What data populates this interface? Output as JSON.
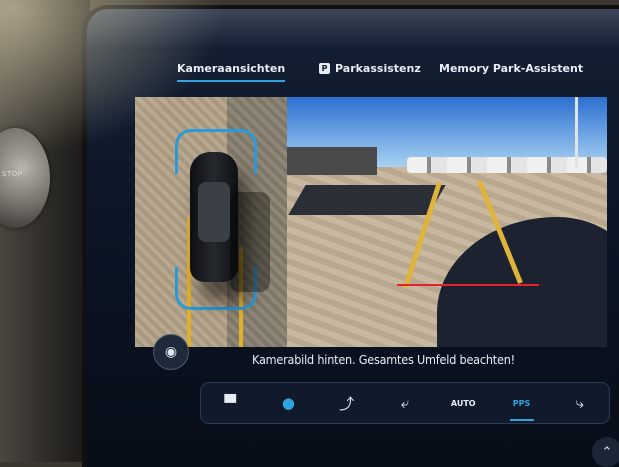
{
  "tabs": [
    {
      "label": "Kameraansichten",
      "active": true
    },
    {
      "label": "Parkassistenz",
      "icon": "parking-p-icon",
      "active": false
    },
    {
      "label": "Memory Park-Assistent",
      "active": false
    }
  ],
  "parking_icon_letter": "P",
  "knob": {
    "label": "STOP"
  },
  "notice": "Kamerabild hinten. Gesamtes Umfeld beachten!",
  "view_buttons": [
    {
      "name": "front-view-icon",
      "glyph": "▀",
      "active": false
    },
    {
      "name": "top-view-icon",
      "glyph": "●",
      "active": false
    },
    {
      "name": "side-view-icon",
      "glyph": "⤴",
      "active": false
    },
    {
      "name": "rear-wheel-view-icon",
      "glyph": "⤶",
      "active": false
    },
    {
      "name": "auto-view-icon",
      "label": "AUTO",
      "active": false
    },
    {
      "name": "pps-view-icon",
      "label": "PPS",
      "active": true
    },
    {
      "name": "trailer-view-icon",
      "glyph": "⤷",
      "active": false
    }
  ],
  "colors": {
    "accent": "#2fa3e0",
    "guide_red": "#e5212a",
    "lane_yellow": "#e0b43a"
  }
}
